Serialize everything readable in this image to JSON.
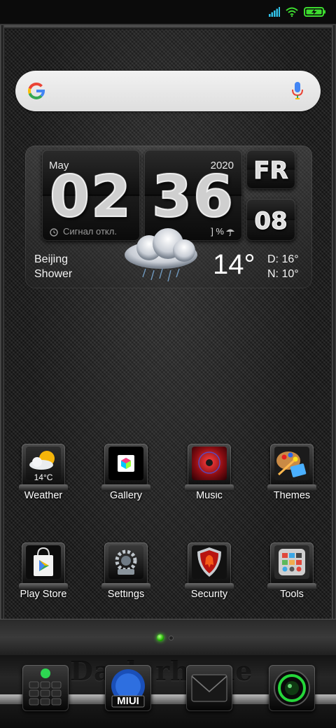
{
  "status_bar": {
    "signal_icon": "cell-signal-icon",
    "wifi_icon": "wifi-icon",
    "battery_icon": "battery-charging-icon",
    "accent_color": "#31c2e8",
    "battery_color": "#3ddc2f"
  },
  "search": {
    "logo": "google-logo",
    "mic_icon": "mic-icon"
  },
  "clock_widget": {
    "month": "May",
    "year": "2020",
    "hour": "02",
    "minute": "36",
    "weekday": "FR",
    "day": "08",
    "alarm_text": "Сигнал откл.",
    "rain_chance": "] %",
    "city": "Beijing",
    "condition": "Shower",
    "temperature": "14°",
    "day_temp": "D:  16°",
    "night_temp": "N:  10°"
  },
  "apps": [
    {
      "label": "Weather",
      "icon": "weather-icon",
      "badge": "14°C"
    },
    {
      "label": "Gallery",
      "icon": "gallery-icon"
    },
    {
      "label": "Music",
      "icon": "music-icon"
    },
    {
      "label": "Themes",
      "icon": "themes-icon"
    },
    {
      "label": "Play Store",
      "icon": "play-store-icon"
    },
    {
      "label": "Settings",
      "icon": "settings-icon"
    },
    {
      "label": "Security",
      "icon": "security-icon"
    },
    {
      "label": "Tools",
      "icon": "tools-icon"
    }
  ],
  "pager": {
    "pages": 2,
    "current": 1
  },
  "dock": {
    "brand_text": "Dark rhyme",
    "items": [
      {
        "icon": "phone-icon"
      },
      {
        "icon": "miui-icon",
        "text": "MIUI"
      },
      {
        "icon": "messages-icon"
      },
      {
        "icon": "camera-icon"
      }
    ]
  }
}
